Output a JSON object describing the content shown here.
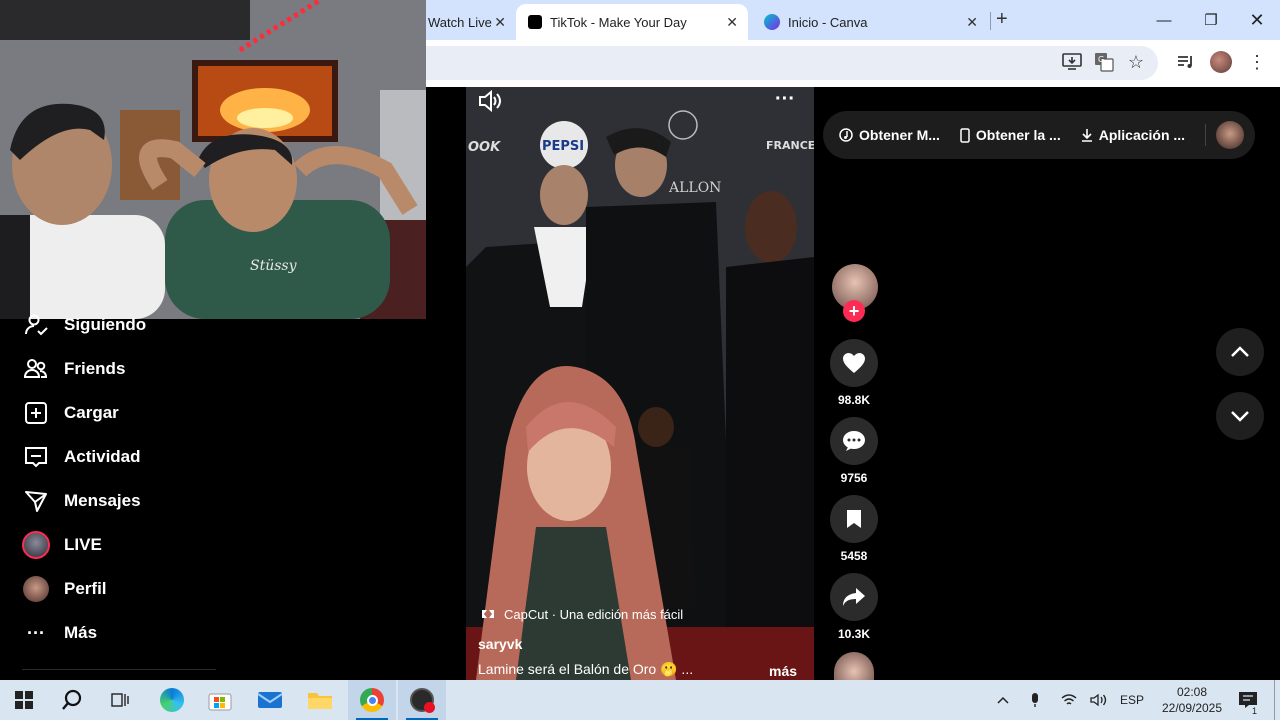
{
  "browser": {
    "tabs": [
      {
        "label": "Watch Live",
        "active": false
      },
      {
        "label": "TikTok - Make Your Day",
        "active": true
      },
      {
        "label": "Inicio - Canva",
        "active": false
      }
    ]
  },
  "sidebar": {
    "items": [
      {
        "label": "Siguiendo",
        "icon": "following-icon"
      },
      {
        "label": "Friends",
        "icon": "friends-icon"
      },
      {
        "label": "Cargar",
        "icon": "upload-icon"
      },
      {
        "label": "Actividad",
        "icon": "activity-icon"
      },
      {
        "label": "Mensajes",
        "icon": "messages-icon"
      },
      {
        "label": "LIVE",
        "icon": "live-avatar-icon"
      },
      {
        "label": "Perfil",
        "icon": "profile-avatar-icon"
      },
      {
        "label": "Más",
        "icon": "more-dots-icon"
      }
    ]
  },
  "video": {
    "capcut_label": "CapCut · Una edición más fácil",
    "author": "saryvk",
    "caption": "Lamine será el Balón de Oro 🫢 ...",
    "more_label": "más"
  },
  "actions": {
    "likes": "98.8K",
    "comments": "9756",
    "saves": "5458",
    "shares": "10.3K"
  },
  "get_bar": {
    "buttons": [
      "Obtener M...",
      "Obtener la ...",
      "Aplicación ..."
    ]
  },
  "taskbar": {
    "language": "ESP",
    "time": "02:08",
    "date": "22/09/2025",
    "notifications": "1"
  },
  "colors": {
    "tiktok_pink": "#fe2c55",
    "chrome_tabstrip": "#d3e3fd",
    "taskbar": "#d9e6f2"
  }
}
